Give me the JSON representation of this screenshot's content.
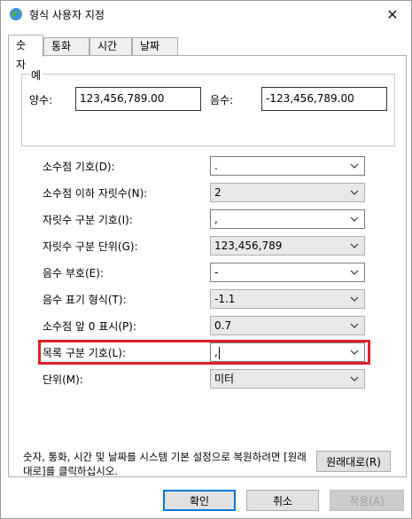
{
  "window": {
    "title": "형식 사용자 지정",
    "close_glyph": "✕"
  },
  "tabs": [
    {
      "label": "숫자"
    },
    {
      "label": "통화"
    },
    {
      "label": "시간"
    },
    {
      "label": "날짜"
    }
  ],
  "sample": {
    "legend": "예",
    "positive_label": "양수:",
    "positive_value": "123,456,789.00",
    "negative_label": "음수:",
    "negative_value": "-123,456,789.00"
  },
  "settings": [
    {
      "label": "소수점 기호(D):",
      "value": ".",
      "editable": true
    },
    {
      "label": "소수점 이하 자릿수(N):",
      "value": "2",
      "editable": false
    },
    {
      "label": "자릿수 구분 기호(I):",
      "value": ",",
      "editable": true
    },
    {
      "label": "자릿수 구분 단위(G):",
      "value": "123,456,789",
      "editable": false
    },
    {
      "label": "음수 부호(E):",
      "value": "-",
      "editable": true
    },
    {
      "label": "음수 표기 형식(T):",
      "value": "-1.1",
      "editable": false
    },
    {
      "label": "소수점 앞 0 표시(P):",
      "value": "0.7",
      "editable": false
    },
    {
      "label": "목록 구분 기호(L):",
      "value": ",",
      "editable": true,
      "highlighted": true
    },
    {
      "label": "단위(M):",
      "value": "미터",
      "editable": false
    }
  ],
  "footer": {
    "note": "숫자, 통화, 시간 및 날짜를 시스템 기본 설정으로 복원하려면 [원래대로]를 클릭하십시오.",
    "reset_button": "원래대로(R)"
  },
  "buttons": {
    "ok": "확인",
    "cancel": "취소",
    "apply": "적용(A)"
  },
  "colors": {
    "highlight": "#e0202a",
    "primary_border": "#0078d7"
  }
}
